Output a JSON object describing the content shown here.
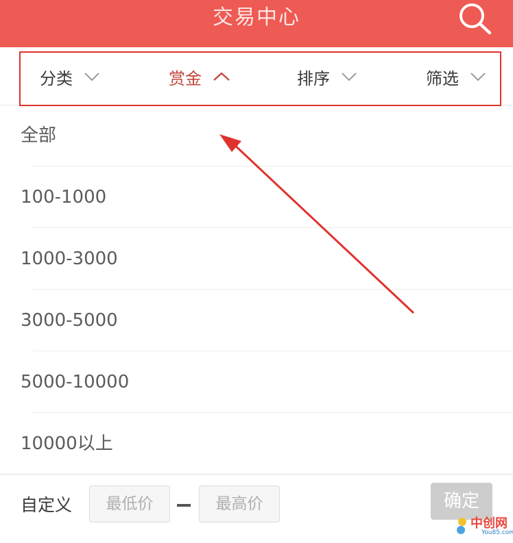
{
  "header": {
    "title": "交易中心",
    "search_icon": "search-icon"
  },
  "filters": {
    "tabs": [
      {
        "label": "分类",
        "arrow": "chevron-down-icon"
      },
      {
        "label": "赏金",
        "arrow": "chevron-up-icon",
        "active": true
      },
      {
        "label": "排序",
        "arrow": "chevron-down-icon"
      },
      {
        "label": "筛选",
        "arrow": "chevron-down-icon"
      }
    ]
  },
  "options": [
    {
      "label": "全部"
    },
    {
      "label": "100-1000"
    },
    {
      "label": "1000-3000"
    },
    {
      "label": "3000-5000"
    },
    {
      "label": "5000-10000"
    },
    {
      "label": "10000以上"
    }
  ],
  "custom": {
    "label": "自定义",
    "min_placeholder": "最低价",
    "max_placeholder": "最高价",
    "confirm_label": "确定"
  },
  "watermark": {
    "brand": "中创网",
    "domain": "You85.com"
  },
  "colors": {
    "header_bg": "#ee5a54",
    "active_tab": "#c2453d",
    "highlight_border": "#e0322c",
    "arrow": "#e0322c"
  }
}
